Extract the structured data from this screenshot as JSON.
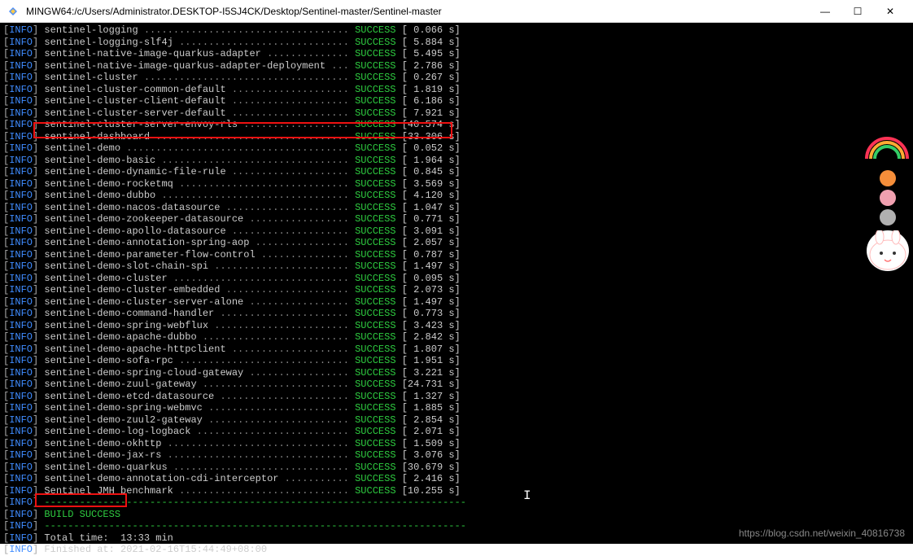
{
  "titlebar": {
    "title": "MINGW64:/c/Users/Administrator.DESKTOP-I5SJ4CK/Desktop/Sentinel-master/Sentinel-master"
  },
  "log": {
    "info": "INFO",
    "lines": [
      {
        "name": "sentinel-logging",
        "status": "SUCCESS",
        "time": " 0.066 s"
      },
      {
        "name": "sentinel-logging-slf4j",
        "status": "SUCCESS",
        "time": " 5.884 s"
      },
      {
        "name": "sentinel-native-image-quarkus-adapter",
        "status": "SUCCESS",
        "time": " 5.495 s"
      },
      {
        "name": "sentinel-native-image-quarkus-adapter-deployment",
        "status": "SUCCESS",
        "time": " 2.786 s"
      },
      {
        "name": "sentinel-cluster",
        "status": "SUCCESS",
        "time": " 0.267 s"
      },
      {
        "name": "sentinel-cluster-common-default",
        "status": "SUCCESS",
        "time": " 1.819 s"
      },
      {
        "name": "sentinel-cluster-client-default",
        "status": "SUCCESS",
        "time": " 6.186 s"
      },
      {
        "name": "sentinel-cluster-server-default",
        "status": "SUCCESS",
        "time": " 7.921 s"
      },
      {
        "name": "sentinel-cluster-server-envoy-rls",
        "status": "SUCCESS",
        "time": "40.574 s"
      },
      {
        "name": "sentinel-dashboard",
        "status": "SUCCESS",
        "time": "33.306 s"
      },
      {
        "name": "sentinel-demo",
        "status": "SUCCESS",
        "time": " 0.052 s"
      },
      {
        "name": "sentinel-demo-basic",
        "status": "SUCCESS",
        "time": " 1.964 s"
      },
      {
        "name": "sentinel-demo-dynamic-file-rule",
        "status": "SUCCESS",
        "time": " 0.845 s"
      },
      {
        "name": "sentinel-demo-rocketmq",
        "status": "SUCCESS",
        "time": " 3.569 s"
      },
      {
        "name": "sentinel-demo-dubbo",
        "status": "SUCCESS",
        "time": " 4.120 s"
      },
      {
        "name": "sentinel-demo-nacos-datasource",
        "status": "SUCCESS",
        "time": " 1.047 s"
      },
      {
        "name": "sentinel-demo-zookeeper-datasource",
        "status": "SUCCESS",
        "time": " 0.771 s"
      },
      {
        "name": "sentinel-demo-apollo-datasource",
        "status": "SUCCESS",
        "time": " 3.091 s"
      },
      {
        "name": "sentinel-demo-annotation-spring-aop",
        "status": "SUCCESS",
        "time": " 2.057 s"
      },
      {
        "name": "sentinel-demo-parameter-flow-control",
        "status": "SUCCESS",
        "time": " 0.787 s"
      },
      {
        "name": "sentinel-demo-slot-chain-spi",
        "status": "SUCCESS",
        "time": " 1.497 s"
      },
      {
        "name": "sentinel-demo-cluster",
        "status": "SUCCESS",
        "time": " 0.095 s"
      },
      {
        "name": "sentinel-demo-cluster-embedded",
        "status": "SUCCESS",
        "time": " 2.073 s"
      },
      {
        "name": "sentinel-demo-cluster-server-alone",
        "status": "SUCCESS",
        "time": " 1.497 s"
      },
      {
        "name": "sentinel-demo-command-handler",
        "status": "SUCCESS",
        "time": " 0.773 s"
      },
      {
        "name": "sentinel-demo-spring-webflux",
        "status": "SUCCESS",
        "time": " 3.423 s"
      },
      {
        "name": "sentinel-demo-apache-dubbo",
        "status": "SUCCESS",
        "time": " 2.842 s"
      },
      {
        "name": "sentinel-demo-apache-httpclient",
        "status": "SUCCESS",
        "time": " 1.807 s"
      },
      {
        "name": "sentinel-demo-sofa-rpc",
        "status": "SUCCESS",
        "time": " 1.951 s"
      },
      {
        "name": "sentinel-demo-spring-cloud-gateway",
        "status": "SUCCESS",
        "time": " 3.221 s"
      },
      {
        "name": "sentinel-demo-zuul-gateway",
        "status": "SUCCESS",
        "time": "24.731 s"
      },
      {
        "name": "sentinel-demo-etcd-datasource",
        "status": "SUCCESS",
        "time": " 1.327 s"
      },
      {
        "name": "sentinel-demo-spring-webmvc",
        "status": "SUCCESS",
        "time": " 1.885 s"
      },
      {
        "name": "sentinel-demo-zuul2-gateway",
        "status": "SUCCESS",
        "time": " 2.854 s"
      },
      {
        "name": "sentinel-demo-log-logback",
        "status": "SUCCESS",
        "time": " 2.071 s"
      },
      {
        "name": "sentinel-demo-okhttp",
        "status": "SUCCESS",
        "time": " 1.509 s"
      },
      {
        "name": "sentinel-demo-jax-rs",
        "status": "SUCCESS",
        "time": " 3.076 s"
      },
      {
        "name": "sentinel-demo-quarkus",
        "status": "SUCCESS",
        "time": "30.679 s"
      },
      {
        "name": "sentinel-demo-annotation-cdi-interceptor",
        "status": "SUCCESS",
        "time": " 2.416 s"
      },
      {
        "name": "Sentinel JMH benchmark",
        "status": "SUCCESS",
        "time": "10.255 s"
      }
    ],
    "divider": "------------------------------------------------------------------------",
    "build_success": "BUILD SUCCESS",
    "total_time": "Total time:  13:33 min",
    "finished_at": "Finished at: 2021-02-16T15:44:49+08:00"
  },
  "watermark": "https://blog.csdn.net/weixin_40816738",
  "widget": {
    "colors": [
      "#f58e3a",
      "#f0a0b0",
      "#b0b0b0"
    ]
  }
}
